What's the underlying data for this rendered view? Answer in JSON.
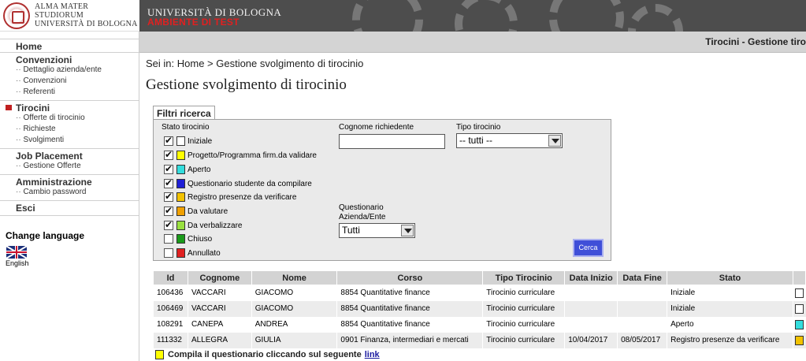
{
  "header": {
    "logo_line1": "ALMA MATER STUDIORUM",
    "logo_line2": "UNIVERSITÀ DI BOLOGNA",
    "university": "UNIVERSITÀ DI BOLOGNA",
    "environment": "AMBIENTE DI TEST",
    "environment_color": "#e02020",
    "module_title": "Tirocini - Gestione tiro"
  },
  "sidebar": {
    "home": "Home",
    "convenzioni": {
      "title": "Convenzioni",
      "items": [
        "Dettaglio azienda/ente",
        "Convenzioni",
        "Referenti"
      ]
    },
    "tirocini": {
      "title": "Tirocini",
      "items": [
        "Offerte di tirocinio",
        "Richieste",
        "Svolgimenti"
      ]
    },
    "job_placement": {
      "title": "Job Placement",
      "items": [
        "Gestione Offerte"
      ]
    },
    "amministrazione": {
      "title": "Amministrazione",
      "items": [
        "Cambio password"
      ]
    },
    "esci": "Esci",
    "change_language": "Change language",
    "language": "English"
  },
  "breadcrumb": "Sei in: Home > Gestione svolgimento di tirocinio",
  "page_title": "Gestione svolgimento di tirocinio",
  "filters": {
    "tab_label": "Filtri ricerca",
    "stato_label": "Stato tirocinio",
    "states": [
      {
        "label": "Iniziale",
        "checked": true,
        "color": "#ffffff"
      },
      {
        "label": "Progetto/Programma firm.da validare",
        "checked": true,
        "color": "#ffff00"
      },
      {
        "label": "Aperto",
        "checked": true,
        "color": "#33dddd"
      },
      {
        "label": "Questionario studente da compilare",
        "checked": true,
        "color": "#1f1fd6"
      },
      {
        "label": "Registro presenze da verificare",
        "checked": true,
        "color": "#f2c200"
      },
      {
        "label": "Da valutare",
        "checked": true,
        "color": "#f0a000"
      },
      {
        "label": "Da verbalizzare",
        "checked": true,
        "color": "#99e040"
      },
      {
        "label": "Chiuso",
        "checked": false,
        "color": "#1a9a1a"
      },
      {
        "label": "Annullato",
        "checked": false,
        "color": "#e02020"
      }
    ],
    "cognome_label": "Cognome richiedente",
    "cognome_value": "",
    "tipo_label": "Tipo tirocinio",
    "tipo_value": "-- tutti --",
    "questionario_label_1": "Questionario",
    "questionario_label_2": "Azienda/Ente",
    "questionario_value": "Tutti",
    "search_button": "Cerca"
  },
  "table": {
    "headers": [
      "Id",
      "Cognome",
      "Nome",
      "Corso",
      "Tipo Tirocinio",
      "Data Inizio",
      "Data Fine",
      "Stato",
      ""
    ],
    "rows": [
      {
        "id": "106436",
        "cognome": "VACCARI",
        "nome": "GIACOMO",
        "corso": "8854 Quantitative finance",
        "tipo": "Tirocinio curriculare",
        "inizio": "",
        "fine": "",
        "stato": "Iniziale",
        "color": "#ffffff"
      },
      {
        "id": "106469",
        "cognome": "VACCARI",
        "nome": "GIACOMO",
        "corso": "8854 Quantitative finance",
        "tipo": "Tirocinio curriculare",
        "inizio": "",
        "fine": "",
        "stato": "Iniziale",
        "color": "#ffffff"
      },
      {
        "id": "108291",
        "cognome": "CANEPA",
        "nome": "ANDREA",
        "corso": "8854 Quantitative finance",
        "tipo": "Tirocinio curriculare",
        "inizio": "",
        "fine": "",
        "stato": "Aperto",
        "color": "#33dddd"
      },
      {
        "id": "111332",
        "cognome": "ALLEGRA",
        "nome": "GIULIA",
        "corso": "0901 Finanza, intermediari e mercati",
        "tipo": "Tirocinio curriculare",
        "inizio": "10/04/2017",
        "fine": "08/05/2017",
        "stato": "Registro presenze da verificare",
        "color": "#f2c200"
      }
    ]
  },
  "footer_note": {
    "text": "Compila il questionario cliccando sul seguente",
    "link": "link",
    "color": "#ffff00"
  }
}
